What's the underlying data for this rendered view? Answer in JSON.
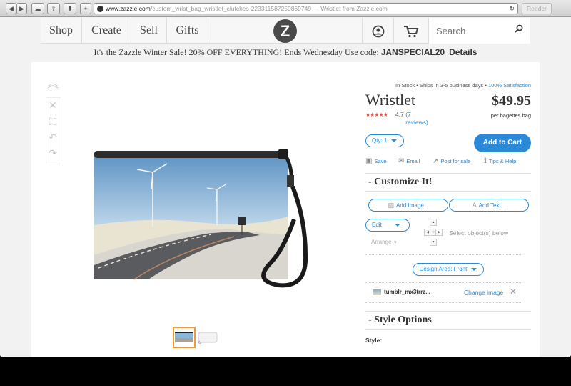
{
  "browser": {
    "url_domain": "www.zazzle.com",
    "url_path": "/custom_wrist_bag_wristlet_clutches-223311587250869749",
    "page_title": " — Wristlet from Zazzle.com",
    "reader_label": "Reader",
    "nav_buttons": [
      "◀",
      "▶"
    ],
    "new_tab_label": "+"
  },
  "nav": {
    "items": [
      "Shop",
      "Create",
      "Sell",
      "Gifts"
    ],
    "logo_glyph": "Z",
    "search_placeholder": "Search",
    "icons": [
      "account-icon",
      "cart-icon",
      "search-icon"
    ]
  },
  "promo": {
    "text": "It's the Zazzle Winter Sale!  20% OFF EVERYTHING!  Ends Wednesday  Use code: ",
    "code": "JANSPECIAL20",
    "details_link": "Details"
  },
  "product": {
    "availability": "In Stock  •  Ships in 3-5 business days  •  ",
    "satisfaction": "100% Satisfaction",
    "title": "Wristlet",
    "price": "$49.95",
    "price_unit": "per bagettes bag",
    "rating_stars": "★★★★★",
    "rating_value": "4.7",
    "rating_reviews": "(7 reviews)",
    "qty_label": "Qty: 1",
    "add_to_cart": "Add to Cart",
    "actions": [
      "Save",
      "Email",
      "Post for sale",
      "Tips & Help"
    ]
  },
  "customize": {
    "heading": "-  Customize It!",
    "add_image": "Add Image...",
    "add_text": "Add Text...",
    "edit_label": "Edit",
    "arrange_label": "Arrange",
    "select_hint": "Select object(s) below",
    "design_area": "Design Area: Front",
    "layer_name": "tumblr_mx3trrz...",
    "change_image": "Change image"
  },
  "style_options": {
    "heading": "-  Style Options",
    "style_label": "Style:"
  },
  "colors": {
    "accent": "#2a8ad8",
    "stars": "#e2513f",
    "thumb_selected": "#f29a3a"
  }
}
